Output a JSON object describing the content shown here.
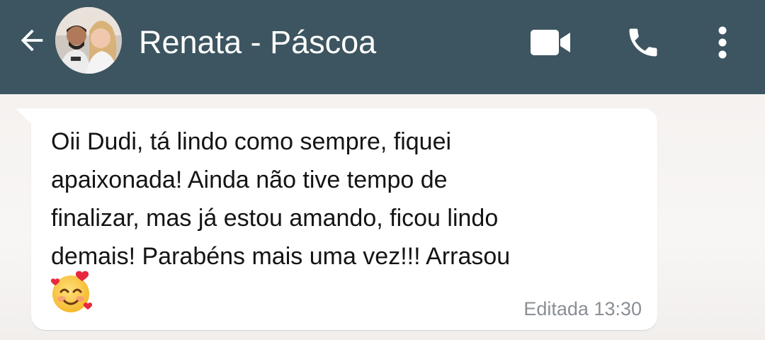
{
  "header": {
    "contact_name": "Renata - Páscoa",
    "background_color": "#3c5560",
    "icons": {
      "back": "arrow-left-icon",
      "video": "video-camera-icon",
      "call": "phone-icon",
      "menu": "more-vert-icon"
    }
  },
  "message": {
    "lines": [
      "Oii Dudi, tá lindo como sempre, fiquei",
      "apaixonada! Ainda não tive tempo de",
      "finalizar, mas já estou amando, ficou lindo",
      "demais! Parabéns mais uma vez!!! Arrasou"
    ],
    "emoji": "smiling-face-with-hearts",
    "status": "Editada",
    "time": "13:30"
  }
}
